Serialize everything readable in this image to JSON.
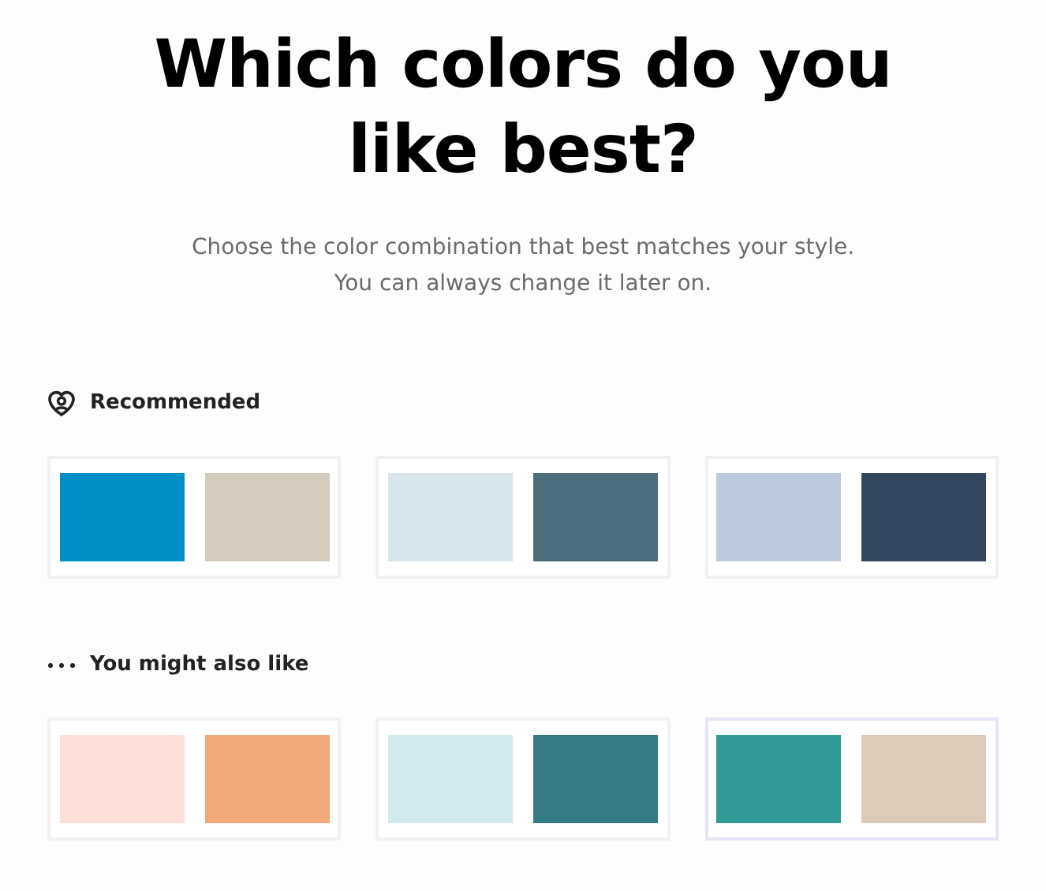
{
  "title": "Which colors do you like best?",
  "subtitle": [
    "Choose the color combination that best matches your style.",
    "You can always change it later on."
  ],
  "sections": [
    {
      "kind": "heart",
      "label": "Recommended",
      "combos": [
        {
          "selected": false,
          "swatches": [
            {
              "color": "#008fc7"
            },
            {
              "color": "#d3cbbd"
            }
          ]
        },
        {
          "selected": false,
          "swatches": [
            {
              "color": "#d8e6eb"
            },
            {
              "color": "#4a6e7b"
            }
          ]
        },
        {
          "selected": false,
          "swatches": [
            {
              "color": "#bccadb"
            },
            {
              "color": "#34475f"
            }
          ]
        }
      ]
    },
    {
      "kind": "dots",
      "label": "You might also like",
      "combos": [
        {
          "selected": false,
          "swatches": [
            {
              "color": "#fde0d9"
            },
            {
              "color": "#f2aa7d"
            }
          ]
        },
        {
          "selected": false,
          "swatches": [
            {
              "color": "#d2e9ee"
            },
            {
              "color": "#377b87"
            }
          ]
        },
        {
          "selected": true,
          "swatches": [
            {
              "color": "#319a94"
            },
            {
              "color": "#dccbba"
            }
          ]
        }
      ]
    }
  ]
}
